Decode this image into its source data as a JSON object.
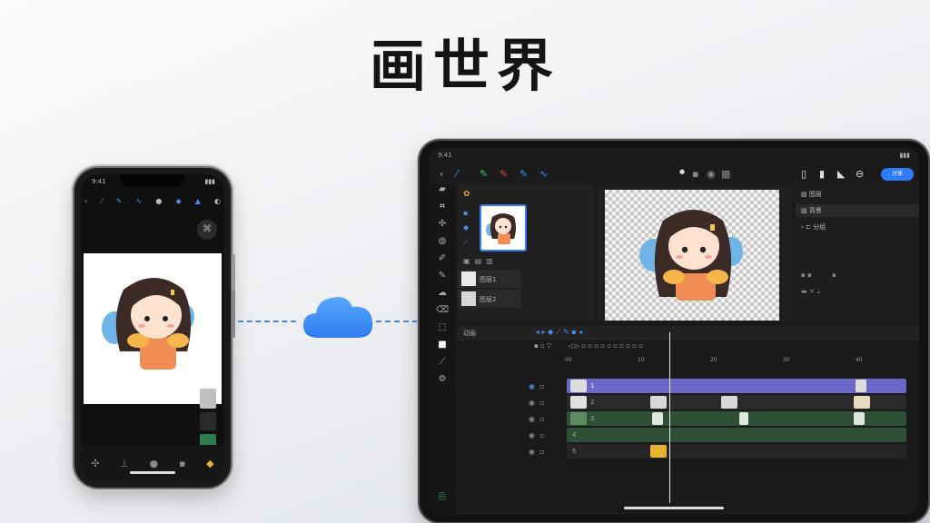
{
  "title": "画世界",
  "accent_color": "#4a86e8",
  "phone": {
    "status_time": "9:41",
    "toolbar_icons": [
      "back-icon",
      "brush-icon",
      "pen-icon",
      "curve-icon",
      "color-icon",
      "layers-icon",
      "fill-icon",
      "settings-icon"
    ],
    "bottom_icons": [
      "tools-icon",
      "select-icon",
      "color-wheel-icon",
      "layers-icon",
      "gallery-icon"
    ]
  },
  "cloud_sync_icon": "cloud-icon",
  "tablet": {
    "status_time": "9:41",
    "share_label": "分享",
    "toolbar_icons": [
      "back-icon",
      "pen-icon",
      "brush-green-icon",
      "brush-red-icon",
      "brush-blue-icon",
      "curve-icon"
    ],
    "layers": [
      {
        "name": "图层1"
      },
      {
        "name": "图层2"
      }
    ],
    "right_panel_rows": [
      "图层",
      "背景",
      "分组"
    ],
    "timeline_label": "动画",
    "ruler_ticks": [
      "00",
      "10",
      "20",
      "30",
      "40"
    ],
    "tracks": [
      {
        "label": "1",
        "color": "#6b68c9"
      },
      {
        "label": "2",
        "color": "#2a2a2a"
      },
      {
        "label": "3",
        "color": "#2f4f36"
      },
      {
        "label": "4",
        "color": "#2f4f36"
      },
      {
        "label": "5",
        "color": "#252525"
      }
    ]
  }
}
